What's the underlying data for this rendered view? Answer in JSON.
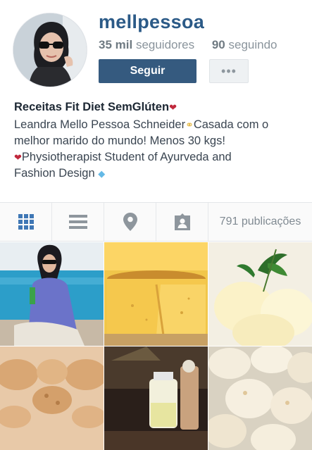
{
  "profile": {
    "username": "mellpessoa",
    "followers_count": "35 mil",
    "followers_label": "seguidores",
    "following_count": "90",
    "following_label": "seguindo",
    "follow_button": "Seguir",
    "more_button": "•••"
  },
  "bio": {
    "title": "Receitas Fit Diet SemGlúten",
    "line1a": "Leandra Mello Pessoa Schneider",
    "line1b": "Casada com o",
    "line2": "melhor marido do mundo! Menos 30 kgs!",
    "line3": "Physiotherapist Student of Ayurveda and",
    "line4": "Fashion Design"
  },
  "tabs": {
    "items": [
      "grid-view",
      "list-view",
      "location-view",
      "tagged-view"
    ],
    "posts_count": "791 publicações",
    "active_color": "#3f77b5",
    "inactive_color": "#8e969d"
  },
  "grid": {
    "posts": [
      "pool-photo",
      "cake-photo",
      "ice-cream-photo",
      "cookies-photo",
      "drinks-photo",
      "bread-rolls-photo"
    ]
  },
  "colors": {
    "username": "#2b5a87",
    "follow_button": "#355a7f",
    "heart": "#c0283c"
  }
}
